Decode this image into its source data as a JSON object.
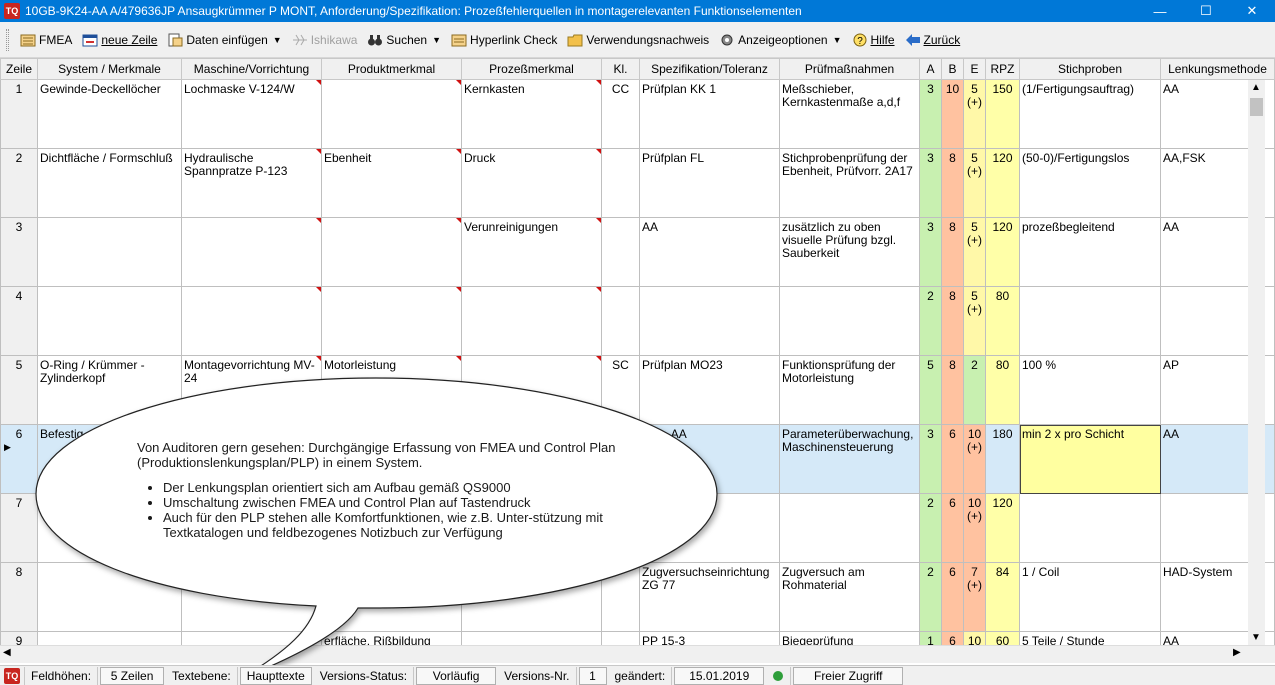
{
  "window": {
    "title": "10GB-9K24-AA  A/479636JP  Ansaugkrümmer  P  MONT,  Anforderung/Spezifikation: Prozeßfehlerquellen in montagerelevanten Funktionselementen",
    "app_icon_label": "TQ",
    "minimize": "—",
    "maximize": "☐",
    "close": "✕"
  },
  "toolbar": {
    "items": [
      {
        "label": "FMEA",
        "icon": "fmea-icon",
        "underline": "F"
      },
      {
        "label": "neue Zeile",
        "icon": "new-row-icon",
        "underline": "n"
      },
      {
        "label": "Daten einfügen",
        "icon": "insert-data-icon",
        "dropdown": true
      },
      {
        "label": "Ishikawa",
        "icon": "ishikawa-icon",
        "disabled": true
      },
      {
        "label": "Suchen",
        "icon": "binoculars-icon",
        "dropdown": true
      },
      {
        "label": "Hyperlink Check",
        "icon": "hyperlink-icon"
      },
      {
        "label": "Verwendungsnachweis",
        "icon": "folder-icon"
      },
      {
        "label": "Anzeigeoptionen",
        "icon": "display-options-icon",
        "dropdown": true
      },
      {
        "label": "Hilfe",
        "icon": "help-icon"
      },
      {
        "label": "Zurück",
        "icon": "back-arrow-icon"
      }
    ]
  },
  "grid": {
    "columns": [
      "Zeile",
      "System / Merkmale",
      "Maschine/Vorrichtung",
      "Produktmerkmal",
      "Prozeßmerkmal",
      "Kl.",
      "Spezifikation/Toleranz",
      "Prüfmaßnahmen",
      "A",
      "B",
      "E",
      "RPZ",
      "Stichproben",
      "Lenkungsmethode"
    ],
    "rows": [
      {
        "zeile": "1",
        "system": "Gewinde-Deckellöcher",
        "maschine": "Lochmaske V-124/W",
        "produkt": "",
        "prozess": "Kernkasten",
        "kl": "CC",
        "spez": "Prüfplan KK 1",
        "pruef": "Meßschieber, Kernkastenmaße a,d,f",
        "a": "3",
        "b": "10",
        "e": "5",
        "e_sub": "(+)",
        "rpz": "150",
        "stich": "(1/Fertigungsauftrag)",
        "lenk": "AA"
      },
      {
        "zeile": "2",
        "system": "Dichtfläche / Formschluß",
        "maschine": "Hydraulische Spannpratze P-123",
        "produkt": "Ebenheit",
        "prozess": "Druck",
        "kl": "",
        "spez": "Prüfplan FL",
        "pruef": "Stichprobenprüfung der Ebenheit, Prüfvorr. 2A17",
        "a": "3",
        "b": "8",
        "e": "5",
        "e_sub": "(+)",
        "rpz": "120",
        "stich": "(50-0)/Fertigungslos",
        "lenk": "AA,FSK"
      },
      {
        "zeile": "3",
        "system": "",
        "maschine": "",
        "produkt": "",
        "prozess": "Verunreinigungen",
        "kl": "",
        "spez": "AA",
        "pruef": "zusätzlich zu oben visuelle Prüfung bzgl. Sauberkeit",
        "a": "3",
        "b": "8",
        "e": "5",
        "e_sub": "(+)",
        "rpz": "120",
        "stich": "prozeßbegleitend",
        "lenk": "AA"
      },
      {
        "zeile": "4",
        "system": "",
        "maschine": "",
        "produkt": "",
        "prozess": "",
        "kl": "",
        "spez": "",
        "pruef": "",
        "a": "2",
        "b": "8",
        "e": "5",
        "e_sub": "(+)",
        "rpz": "80",
        "stich": "",
        "lenk": ""
      },
      {
        "zeile": "5",
        "system": "O-Ring / Krümmer - Zylinderkopf",
        "maschine": "Montagevorrichtung MV-24",
        "produkt": "Motorleistung",
        "prozess": "",
        "kl": "SC",
        "spez": "Prüfplan MO23",
        "pruef": "Funktionsprüfung der Motorleistung",
        "a": "5",
        "b": "8",
        "e": "2",
        "e_sub": "",
        "rpz": "80",
        "stich": "100 %",
        "lenk": "AP"
      },
      {
        "zeile": "6",
        "system": "Befestig",
        "maschine": "",
        "produkt": "",
        "prozess": "",
        "kl": "",
        "spez": "plan, AA",
        "pruef": "Parameterüberwachung, Maschinensteuerung",
        "a": "3",
        "b": "6",
        "e": "10",
        "e_sub": "(+)",
        "rpz": "180",
        "stich": "min 2 x pro Schicht",
        "lenk": "AA"
      },
      {
        "zeile": "7",
        "system": "",
        "maschine": "",
        "produkt": "",
        "prozess": "",
        "kl": "",
        "spez": "",
        "pruef": "",
        "a": "2",
        "b": "6",
        "e": "10",
        "e_sub": "(+)",
        "rpz": "120",
        "stich": "",
        "lenk": ""
      },
      {
        "zeile": "8",
        "system": "",
        "maschine": "",
        "produkt": "",
        "prozess": "",
        "kl": "",
        "spez": "Zugversuchseinrichtung ZG 77",
        "pruef": "Zugversuch am Rohmaterial",
        "a": "2",
        "b": "6",
        "e": "7",
        "e_sub": "(+)",
        "rpz": "84",
        "stich": "1 / Coil",
        "lenk": "HAD-System"
      },
      {
        "zeile": "9",
        "system": "",
        "maschine": "",
        "produkt": "erfläche, Rißbildung",
        "prozess": "",
        "kl": "",
        "spez": "PP 15-3",
        "pruef": "Biegeprüfung",
        "a": "1",
        "b": "6",
        "e": "10",
        "e_sub": "",
        "rpz": "60",
        "stich": "5 Teile / Stunde",
        "lenk": "AA"
      }
    ]
  },
  "callout": {
    "intro": "Von Auditoren gern gesehen: Durchgängige Erfassung von FMEA und Control Plan (Produktionslenkungsplan/PLP) in einem System.",
    "bullets": [
      "Der Lenkungsplan orientiert sich am Aufbau gemäß QS9000",
      "Umschaltung zwischen FMEA und Control Plan auf Tastendruck",
      "Auch für den PLP stehen alle Komfortfunktionen, wie z.B. Unter-stützung mit Textkatalogen und feldbezogenes Notizbuch zur Verfügung"
    ]
  },
  "status": {
    "feldhoehen_label": "Feldhöhen:",
    "feldhoehen_value": "5 Zeilen",
    "textebene_label": "Textebene:",
    "textebene_value": "Haupttexte",
    "versions_status_label": "Versions-Status:",
    "versions_status_value": "Vorläufig",
    "versions_nr_label": "Versions-Nr.",
    "versions_nr_value": "1",
    "geaendert_label": "geändert:",
    "geaendert_value": "15.01.2019",
    "access_value": "Freier Zugriff"
  },
  "colors": {
    "titlebar": "#0078d7",
    "col_a": "#c8f0b0",
    "col_b": "#ffc2a0",
    "col_e": "#fff8a8",
    "selected_row": "#d5e9f8"
  }
}
